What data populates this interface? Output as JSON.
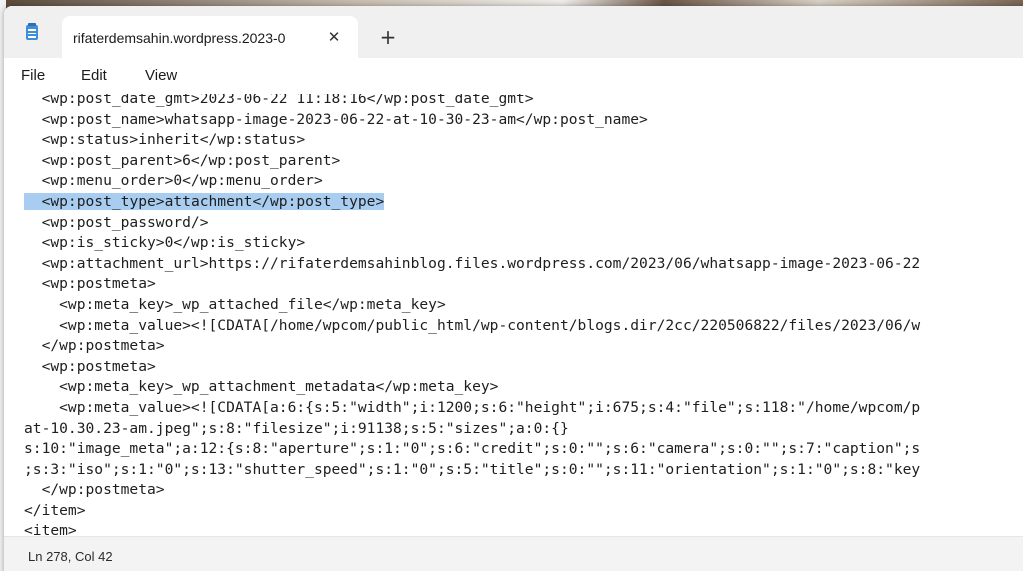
{
  "window": {
    "tab_title": "rifaterdemsahin.wordpress.2023-0",
    "close_glyph": "✕",
    "new_tab_glyph": "+"
  },
  "menu": {
    "items": [
      "File",
      "Edit",
      "View"
    ]
  },
  "editor": {
    "lines": [
      "  <wp:post_date_gmt>2023-06-22 11:18:16</wp:post_date_gmt>",
      "  <wp:post_name>whatsapp-image-2023-06-22-at-10-30-23-am</wp:post_name>",
      "  <wp:status>inherit</wp:status>",
      "  <wp:post_parent>6</wp:post_parent>",
      "  <wp:menu_order>0</wp:menu_order>",
      "  <wp:post_type>attachment</wp:post_type>",
      "  <wp:post_password/>",
      "  <wp:is_sticky>0</wp:is_sticky>",
      "  <wp:attachment_url>https://rifaterdemsahinblog.files.wordpress.com/2023/06/whatsapp-image-2023-06-22",
      "  <wp:postmeta>",
      "    <wp:meta_key>_wp_attached_file</wp:meta_key>",
      "    <wp:meta_value><![CDATA[/home/wpcom/public_html/wp-content/blogs.dir/2cc/220506822/files/2023/06/w",
      "  </wp:postmeta>",
      "  <wp:postmeta>",
      "    <wp:meta_key>_wp_attachment_metadata</wp:meta_key>",
      "    <wp:meta_value><![CDATA[a:6:{s:5:\"width\";i:1200;s:6:\"height\";i:675;s:4:\"file\";s:118:\"/home/wpcom/p",
      "at-10.30.23-am.jpeg\";s:8:\"filesize\";i:91138;s:5:\"sizes\";a:0:{}",
      "s:10:\"image_meta\";a:12:{s:8:\"aperture\";s:1:\"0\";s:6:\"credit\";s:0:\"\";s:6:\"camera\";s:0:\"\";s:7:\"caption\";s",
      ";s:3:\"iso\";s:1:\"0\";s:13:\"shutter_speed\";s:1:\"0\";s:5:\"title\";s:0:\"\";s:11:\"orientation\";s:1:\"0\";s:8:\"key",
      "  </wp:postmeta>",
      "</item>",
      "<item>"
    ],
    "selected_line": 5
  },
  "status": {
    "position": "Ln 278, Col 42"
  },
  "colors": {
    "selection": "#a8cdf0",
    "app_icon": "#3f8fd8"
  },
  "icons": {
    "app": "notepad-icon",
    "close": "close-icon",
    "new_tab": "plus-icon"
  }
}
